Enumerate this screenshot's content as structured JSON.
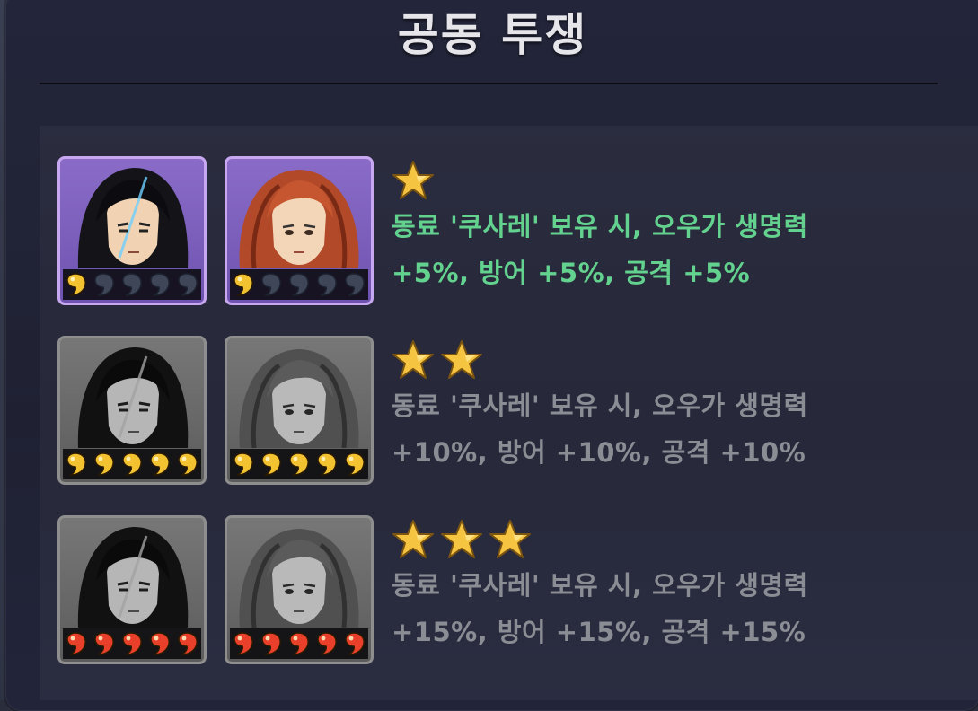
{
  "title": "공동 투쟁",
  "tiers": [
    {
      "stars": 1,
      "active": true,
      "text_line1": "동료 '쿠사레' 보유 시, 오우가 생명력",
      "text_line2": "+5%, 방어 +5%, 공격 +5%",
      "token_color": "gold",
      "tokens_filled": 1,
      "tokens_total": 5
    },
    {
      "stars": 2,
      "active": false,
      "text_line1": "동료 '쿠사레' 보유 시, 오우가 생명력",
      "text_line2": "+10%, 방어 +10%, 공격 +10%",
      "token_color": "gold",
      "tokens_filled": 5,
      "tokens_total": 5
    },
    {
      "stars": 3,
      "active": false,
      "text_line1": "동료 '쿠사레' 보유 시, 오우가 생명력",
      "text_line2": "+15%, 방어 +15%, 공격 +15%",
      "token_color": "red",
      "tokens_filled": 5,
      "tokens_total": 5
    }
  ],
  "colors": {
    "active_text": "#63d28e",
    "inactive_text": "#8b8d94",
    "star": "#f5c542",
    "token_gold": "#f2c230",
    "token_red": "#e8402a",
    "token_empty": "#3e4658"
  },
  "icons": {
    "star": "star-icon",
    "token": "magatama-icon",
    "hero_1": "black-haired-warrior-portrait",
    "hero_2": "red-haired-companion-portrait"
  }
}
